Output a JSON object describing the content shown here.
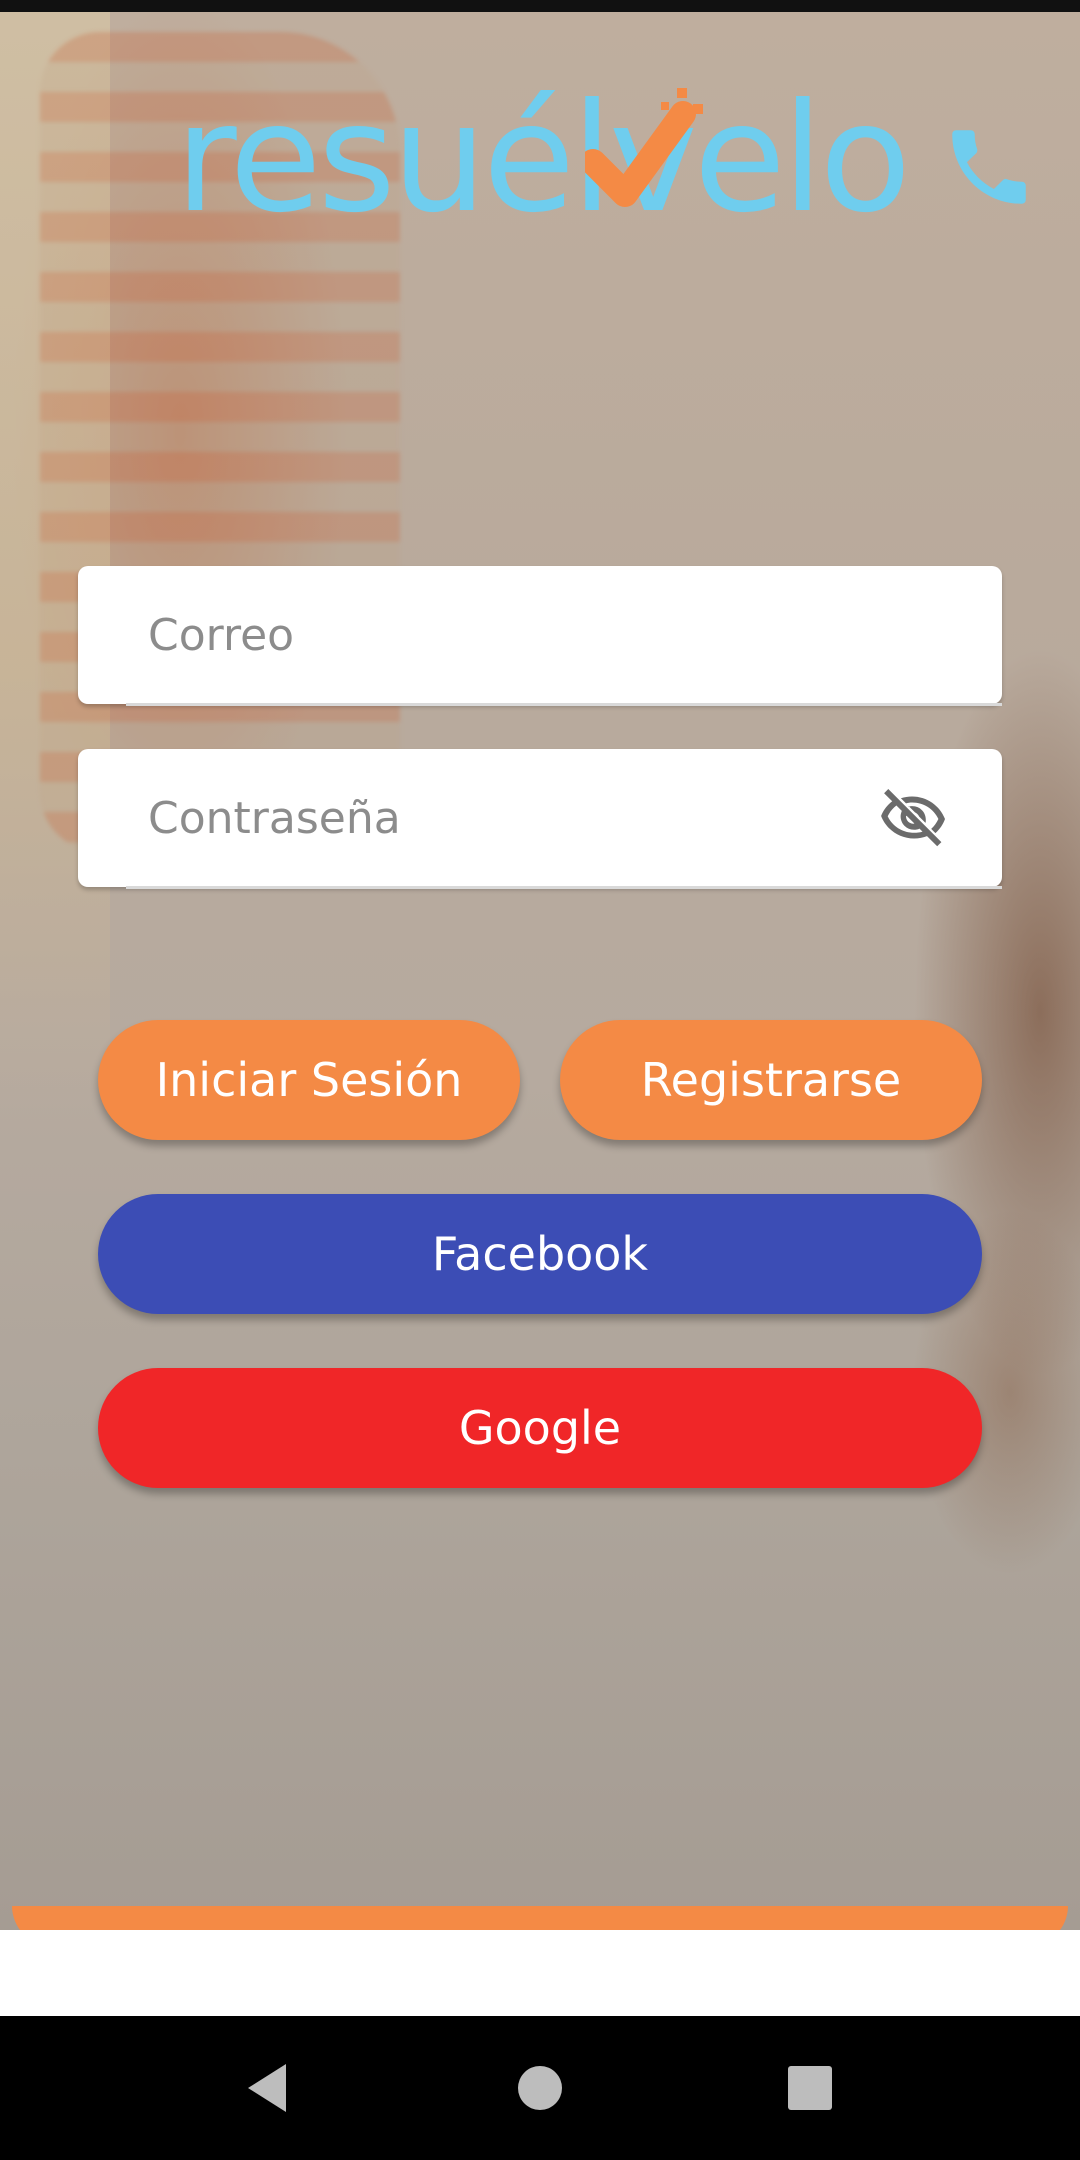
{
  "app": {
    "logo_text": "resuélvelo",
    "colors": {
      "logo_blue": "#6fcdee",
      "accent_orange": "#f48a45",
      "facebook_blue": "#3c4db5",
      "google_red": "#f02628"
    }
  },
  "header": {
    "call_icon": "phone-icon"
  },
  "form": {
    "email": {
      "placeholder": "Correo",
      "value": ""
    },
    "password": {
      "placeholder": "Contraseña",
      "value": "",
      "toggle_icon": "eye-off-icon"
    }
  },
  "buttons": {
    "login_label": "Iniciar Sesión",
    "register_label": "Registrarse",
    "facebook_label": "Facebook",
    "google_label": "Google"
  },
  "nav": {
    "back_icon": "back-triangle-icon",
    "home_icon": "home-circle-icon",
    "recent_icon": "recent-square-icon"
  }
}
